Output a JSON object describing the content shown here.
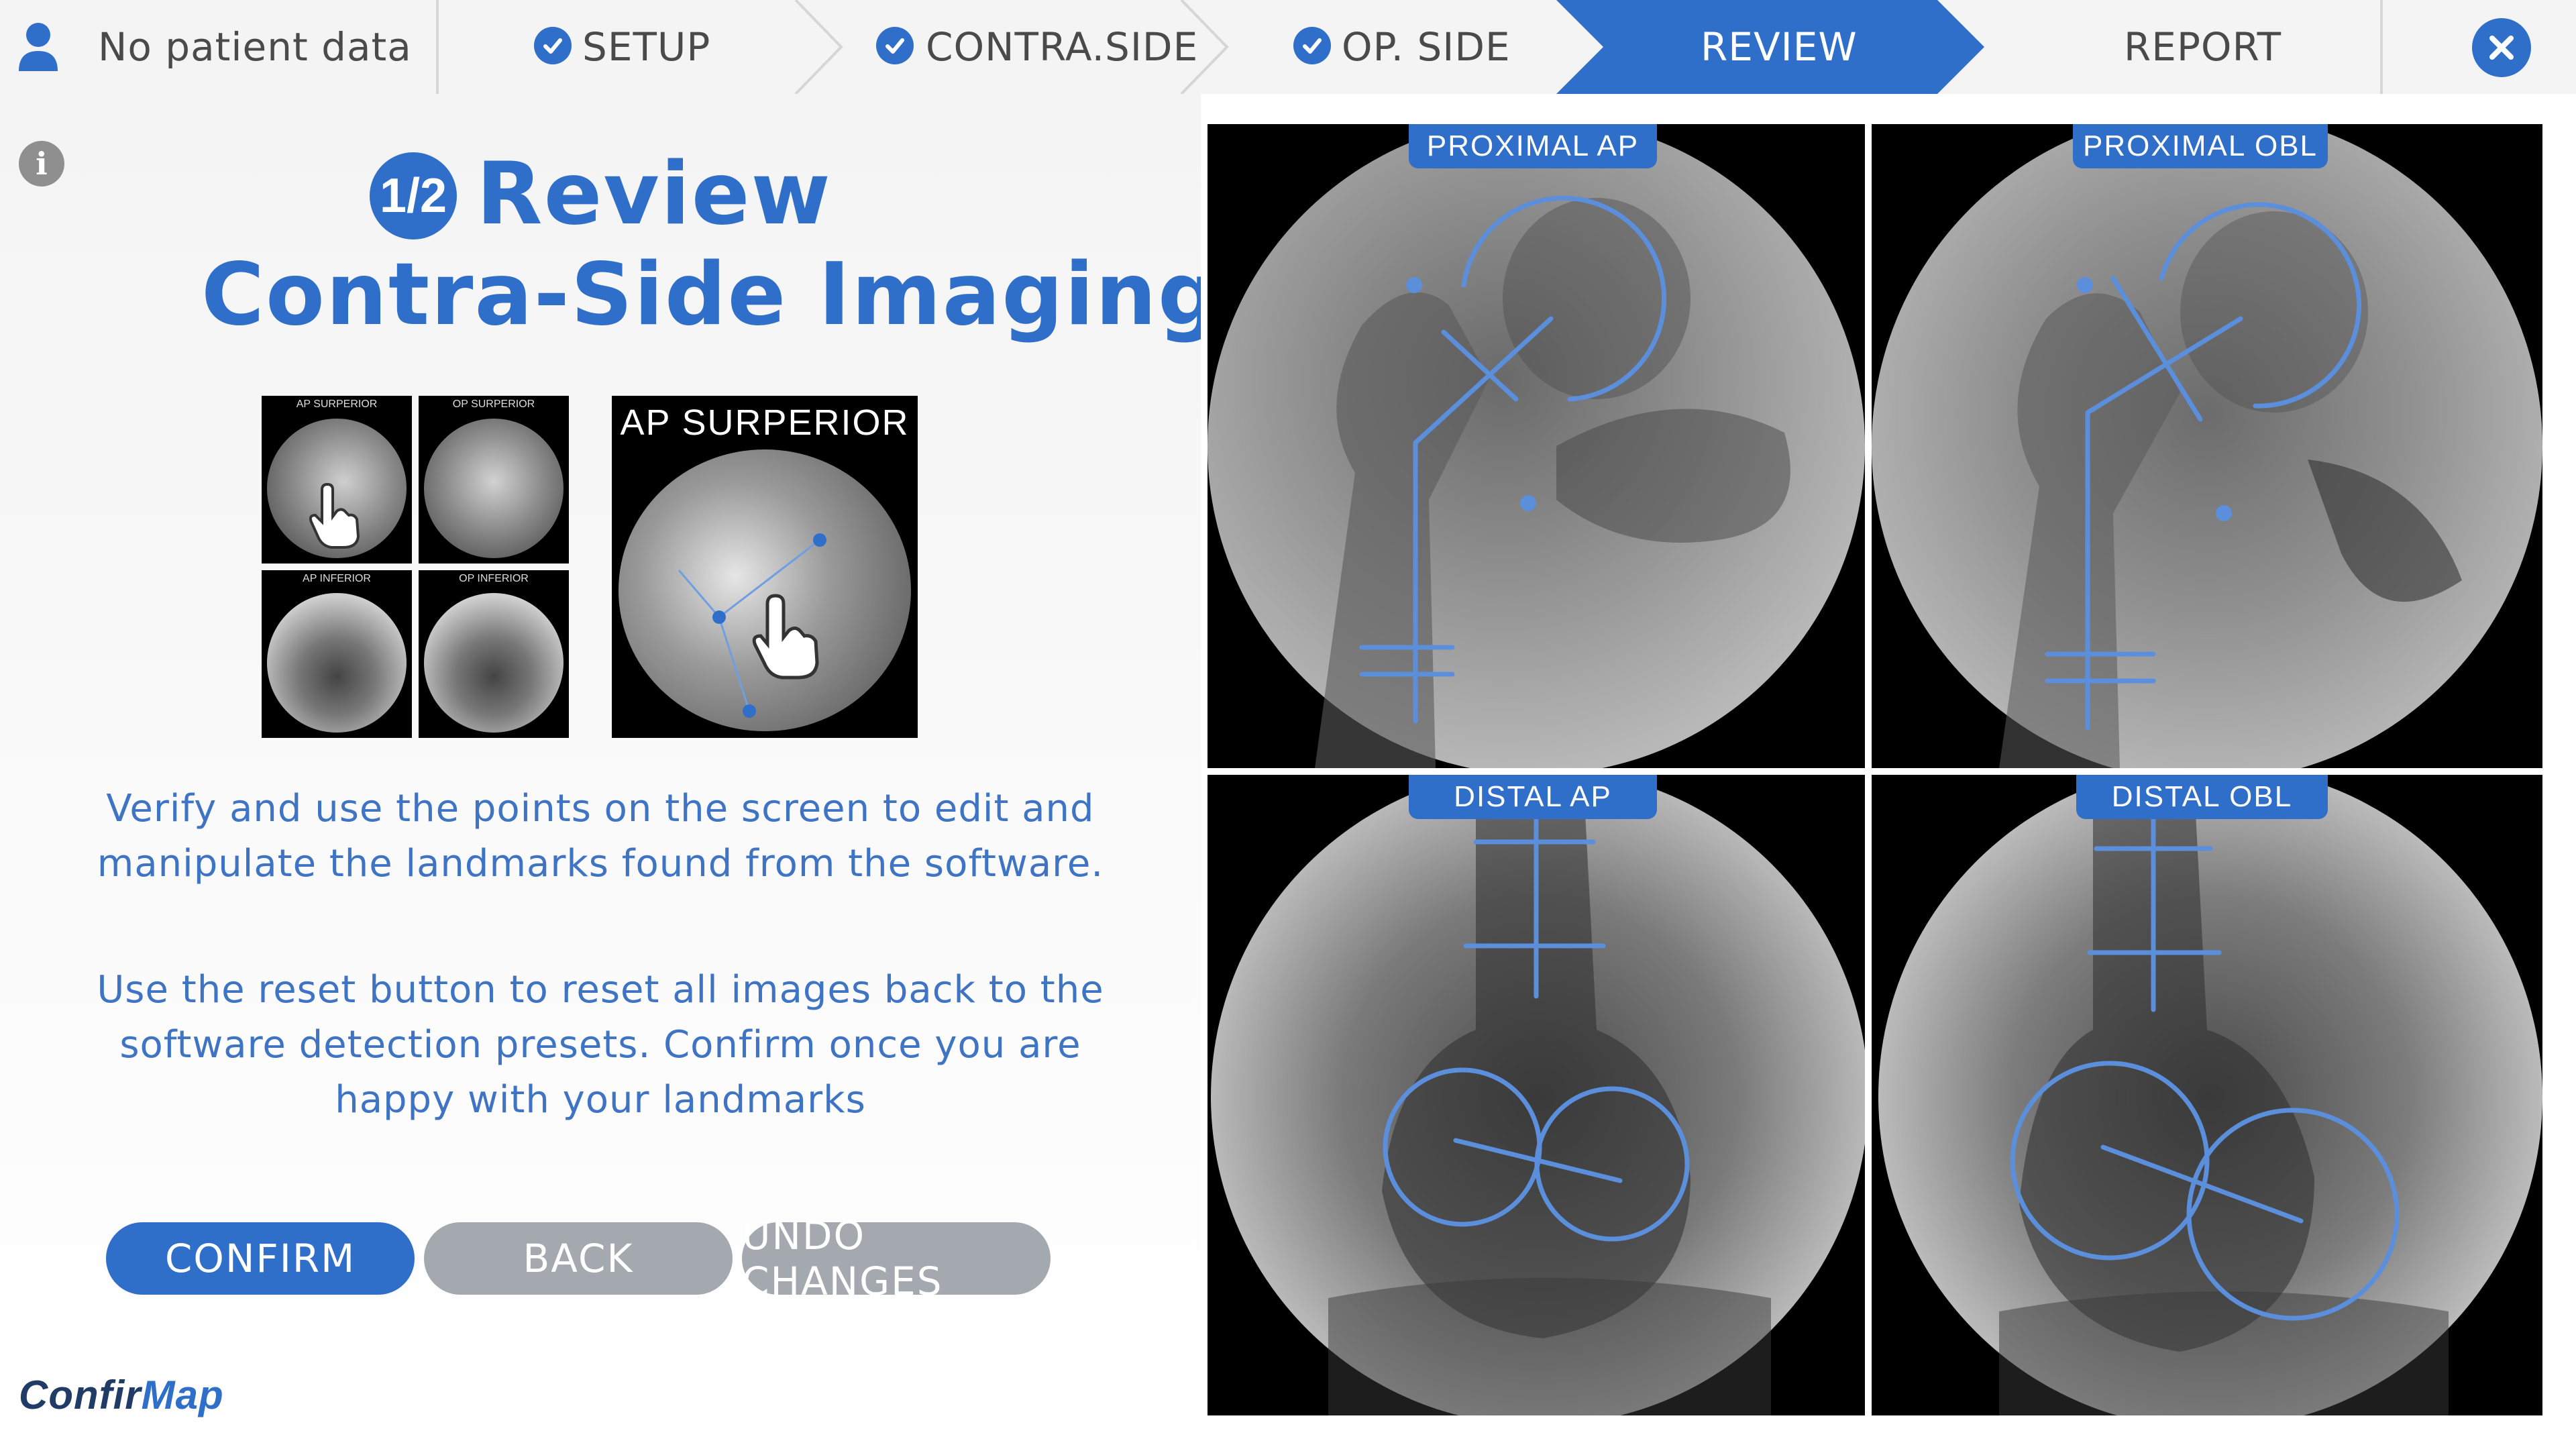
{
  "topbar": {
    "patient": "No patient data",
    "steps": [
      {
        "label": "SETUP",
        "done": true
      },
      {
        "label": "CONTRA.SIDE",
        "done": true
      },
      {
        "label": "OP. SIDE",
        "done": true
      },
      {
        "label": "REVIEW",
        "active": true
      },
      {
        "label": "REPORT"
      }
    ],
    "accent": "#2f6fc9"
  },
  "left": {
    "step_badge": "1/2",
    "title_line1": "Review",
    "title_line2": "Contra-Side Imaging",
    "thumbnails": [
      "AP SURPERIOR",
      "OP SURPERIOR",
      "AP INFERIOR",
      "OP INFERIOR"
    ],
    "preview_label": "AP SURPERIOR",
    "instructions": [
      "Verify and use the points on the screen to edit and",
      "manipulate the landmarks found from the software."
    ],
    "reset_note": [
      "Use the reset button to reset all images back to the",
      "software detection presets. Confirm once you are",
      "happy with your landmarks"
    ],
    "buttons": {
      "confirm": "CONFIRM",
      "back": "BACK",
      "undo": "UNDO CHANGES"
    },
    "logo_part1": "Confir",
    "logo_part2": "Map"
  },
  "images": [
    {
      "label": "PROXIMAL AP"
    },
    {
      "label": "PROXIMAL OBL"
    },
    {
      "label": "DISTAL AP"
    },
    {
      "label": "DISTAL OBL"
    }
  ]
}
